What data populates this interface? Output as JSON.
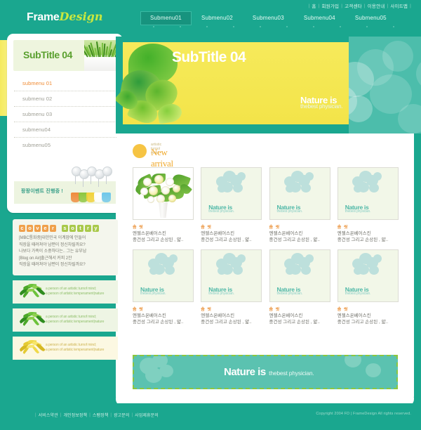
{
  "site": {
    "logo_frame": "Frame",
    "logo_design": "Design"
  },
  "utility_nav": {
    "items": [
      "홈",
      "회원가입",
      "고객센타",
      "이용안내",
      "사이트맵"
    ]
  },
  "main_nav": {
    "items": [
      {
        "label": "Submenu01",
        "active": true
      },
      {
        "label": "Submenu02",
        "active": false
      },
      {
        "label": "Submenu03",
        "active": false
      },
      {
        "label": "Submenu04",
        "active": false
      },
      {
        "label": "Submenu05",
        "active": false
      }
    ]
  },
  "sidebar": {
    "title": "SubTitle 04",
    "menu": [
      {
        "label": "submenu 01",
        "active": true
      },
      {
        "label": "submenu 02",
        "active": false
      },
      {
        "label": "submenu 03",
        "active": false
      },
      {
        "label": "submenu04",
        "active": false
      },
      {
        "label": "submenu05",
        "active": false
      }
    ],
    "banner_text": "팡팡이벤트 진행중 !"
  },
  "hero": {
    "title": "SubTitle 04",
    "tagline_main": "Nature is",
    "tagline_sub": "thebest physician."
  },
  "new_arrival": {
    "kicker": "artistic turnol mind",
    "title": "New arrival"
  },
  "products": [
    {
      "label": "솜 씻",
      "line1": "엔젤스온베어스킨",
      "line2": "중건성 그리고 손상된 , 얇..",
      "type": "photo"
    },
    {
      "label": "솜 씻",
      "line1": "엔젤스온베어스킨",
      "line2": "중건성 그리고 손상된 , 얇..",
      "type": "placeholder"
    },
    {
      "label": "솜 씻",
      "line1": "엔젤스온베어스킨",
      "line2": "중건성 그리고 손상된 , 얇..",
      "type": "placeholder"
    },
    {
      "label": "솜 씻",
      "line1": "엔젤스온베어스킨",
      "line2": "중건성 그리고 손상된 , 얇..",
      "type": "placeholder"
    },
    {
      "label": "솜 씻",
      "line1": "엔젤스온베어스킨",
      "line2": "중건성 그리고 손상된 , 얇..",
      "type": "placeholder"
    },
    {
      "label": "솜 씻",
      "line1": "엔젤스온베어스킨",
      "line2": "중건성 그리고 손상된 , 얇..",
      "type": "placeholder"
    },
    {
      "label": "솜 씻",
      "line1": "엔젤스온베어스킨",
      "line2": "중건성 그리고 손상된 , 얇..",
      "type": "placeholder"
    },
    {
      "label": "솜 씻",
      "line1": "엔젤스온베어스킨",
      "line2": "중건성 그리고 손상된 , 얇..",
      "type": "placeholder"
    }
  ],
  "placeholder_card": {
    "main": "Nature is",
    "sub": "thebest physician."
  },
  "bottom_banner": {
    "main": "Nature is",
    "sub": "thebest physician."
  },
  "cover_story": {
    "title_letters": [
      "c",
      "o",
      "v",
      "e",
      "r",
      "s",
      "o",
      "t",
      "r",
      "y"
    ],
    "lines": [
      "[MBC통화중]대한민국 이계맘에 안들어",
      "직장을 때려쳐야 남편이 정신차릴까요?",
      "나보다 가족이 소중하다는.. 그는 유부남",
      "[Blog on Air]출근해서 커피 2잔",
      "직장을 때려쳐야 남편이 정신차릴까요?"
    ]
  },
  "leaf_items": [
    {
      "line1": "a person of an artistic turnof mind;",
      "line2": "a person of artistic temperament|nature",
      "tone": "green"
    },
    {
      "line1": "a person of an artistic turnof mind;",
      "line2": "a person of artistic temperament|nature",
      "tone": "green"
    },
    {
      "line1": "a person of an artistic turnof mind;",
      "line2": "a person of artistic temperament|nature",
      "tone": "yellow"
    }
  ],
  "footer": {
    "links": [
      "서비스약관",
      "개인정보정책",
      "스팸정책",
      "광고문의",
      "사업제휴문의"
    ],
    "copyright": "Copyright 2004  FD | FrameDesign  All rights reserved."
  },
  "colors": {
    "teal": "#1aa78f",
    "yellow": "#f3e449",
    "orange": "#f08a32",
    "leaf_green": "#5aa832",
    "banner_teal": "#5bc2b0"
  }
}
